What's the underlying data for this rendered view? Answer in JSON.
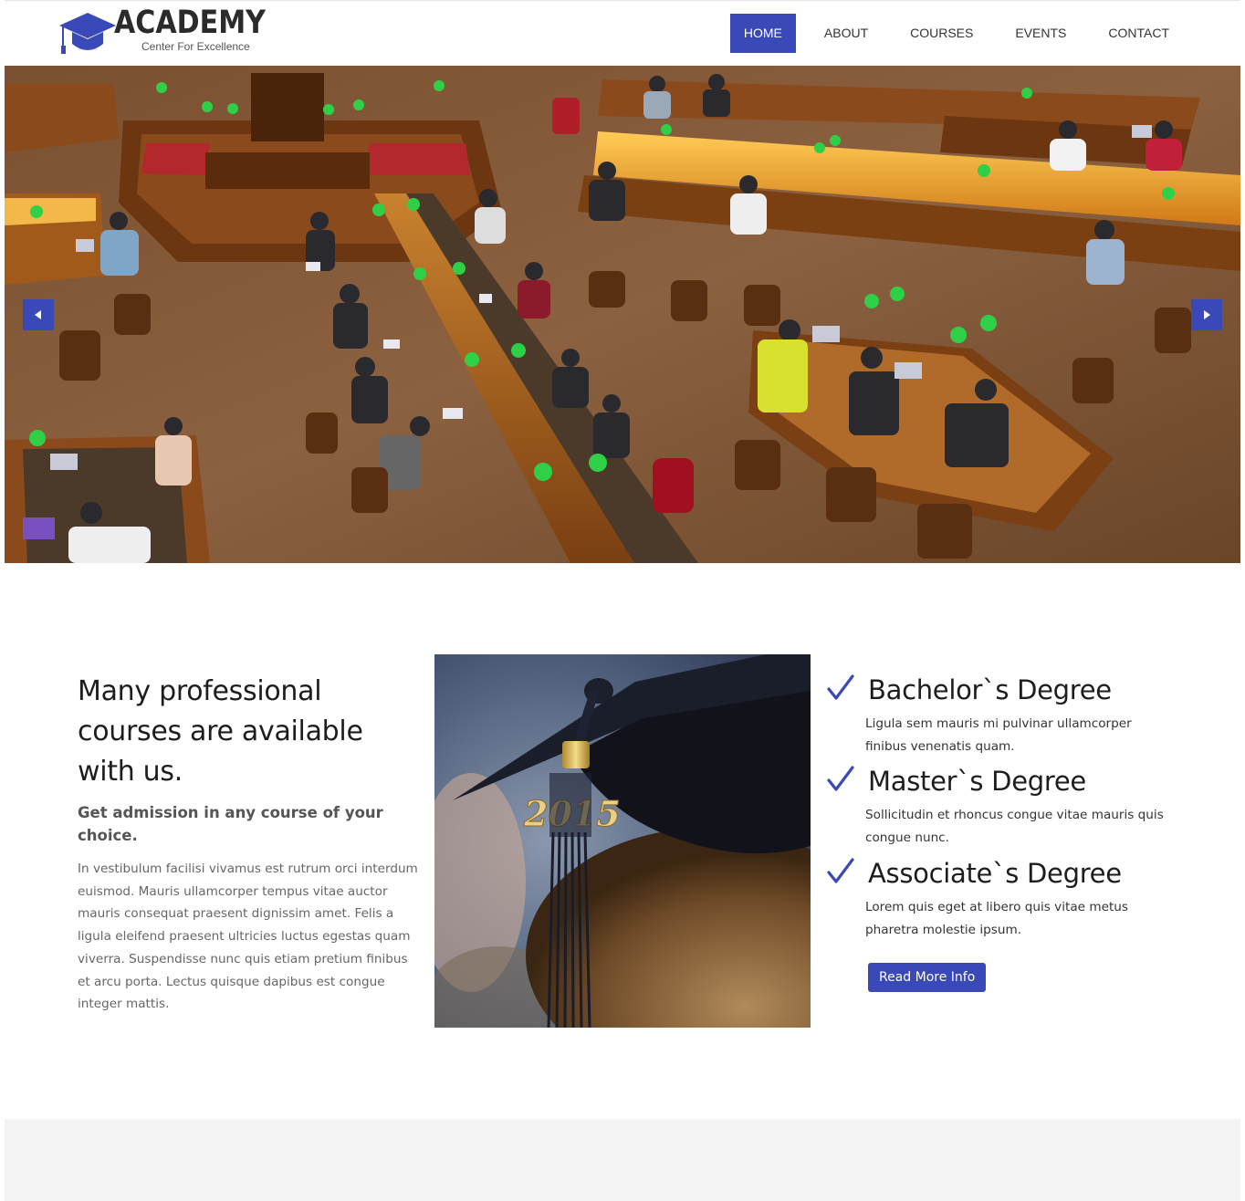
{
  "brand": {
    "name": "ACADEMY",
    "tagline": "Center For Excellence"
  },
  "nav": {
    "items": [
      {
        "label": "HOME"
      },
      {
        "label": "ABOUT"
      },
      {
        "label": "COURSES"
      },
      {
        "label": "EVENTS"
      },
      {
        "label": "CONTACT"
      }
    ],
    "active": "HOME"
  },
  "intro": {
    "heading": "Many professional courses are available with us.",
    "subheading": "Get admission in any course of your choice.",
    "body": "In vestibulum facilisi vivamus est rutrum orci interdum euismod. Mauris ullamcorper tempus vitae auctor mauris consequat praesent dignissim amet. Felis a ligula eleifend praesent ultricies luctus egestas quam viverra. Suspendisse nunc quis etiam pretium finibus et arcu porta. Lectus quisque dapibus est congue integer mattis."
  },
  "grad_photo": {
    "tassel_charm": "2015"
  },
  "degrees": [
    {
      "title": "Bachelor`s Degree",
      "text": "Ligula sem mauris mi pulvinar ullamcorper finibus venenatis quam."
    },
    {
      "title": "Master`s Degree",
      "text": "Sollicitudin et rhoncus congue vitae mauris quis congue nunc."
    },
    {
      "title": "Associate`s Degree",
      "text": "Lorem quis eget at libero quis vitae metus pharetra molestie ipsum."
    }
  ],
  "cta": {
    "read_more": "Read More Info"
  },
  "icons": {
    "logo": "graduation-cap-icon",
    "prev": "caret-left-icon",
    "next": "caret-right-icon",
    "check": "checkmark-icon"
  },
  "colors": {
    "accent": "#3a49b8",
    "text_dark": "#1d1d1d",
    "text_muted": "#666666",
    "footer_band": "#f3f3f3"
  }
}
